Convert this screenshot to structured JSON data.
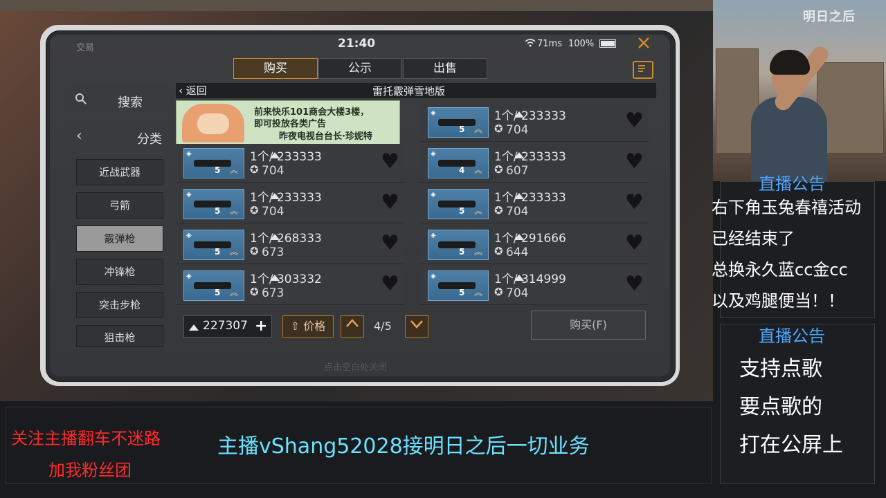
{
  "phone": {
    "status": {
      "left_label": "交易",
      "time": "21:40",
      "ping": "71ms",
      "battery": "100%"
    },
    "tabs": [
      "购买",
      "公示",
      "出售"
    ],
    "sidebar": {
      "search_label": "搜索",
      "category_label": "分类",
      "categories": [
        "近战武器",
        "弓箭",
        "霰弹枪",
        "冲锋枪",
        "突击步枪",
        "狙击枪"
      ],
      "active_category": "霰弹枪"
    },
    "header": {
      "back_label": "返回",
      "title": "雷托霰弹雪地版"
    },
    "ad": {
      "line1": "前来快乐101商会大楼3楼，",
      "line2": "即可投放各类广告",
      "line3": "昨夜电视台台长·珍妮特"
    },
    "listings_left": [
      {
        "level": "5",
        "price": "1个/ 233333",
        "rep": "704"
      },
      {
        "level": "5",
        "price": "1个/ 233333",
        "rep": "704"
      },
      {
        "level": "5",
        "price": "1个/ 268333",
        "rep": "673"
      },
      {
        "level": "5",
        "price": "1个/ 303332",
        "rep": "673"
      }
    ],
    "listings_right": [
      {
        "level": "5",
        "price": "1个/ 233333",
        "rep": "704"
      },
      {
        "level": "4",
        "price": "1个/ 233333",
        "rep": "607"
      },
      {
        "level": "5",
        "price": "1个/ 233333",
        "rep": "704"
      },
      {
        "level": "5",
        "price": "1个/ 291666",
        "rep": "644"
      },
      {
        "level": "5",
        "price": "1个/ 314999",
        "rep": "704"
      }
    ],
    "footer": {
      "balance": "227307",
      "price_sort_label": "价格",
      "page": "4/5",
      "buy_label": "购买(F)",
      "hint": "点击空白处关闭"
    }
  },
  "stream": {
    "brand": "明日之后",
    "notice1": {
      "title": "直播公告",
      "lines": [
        "右下角玉兔春禧活动",
        "已经结束了",
        "总换永久蓝cc金cc",
        "以及鸡腿便当！！"
      ]
    },
    "notice2": {
      "title": "直播公告",
      "lines": [
        "支持点歌",
        "要点歌的",
        "打在公屏上"
      ]
    },
    "bottom_left": [
      "关注主播翻车不迷路",
      "加我粉丝团"
    ],
    "banner": "主播vShang52028接明日之后一切业务"
  },
  "colors": {
    "accent_orange": "#d08a2e",
    "notice_blue": "#4da6ff",
    "banner_cyan": "#6be1ff",
    "red": "#ff2a2a"
  }
}
